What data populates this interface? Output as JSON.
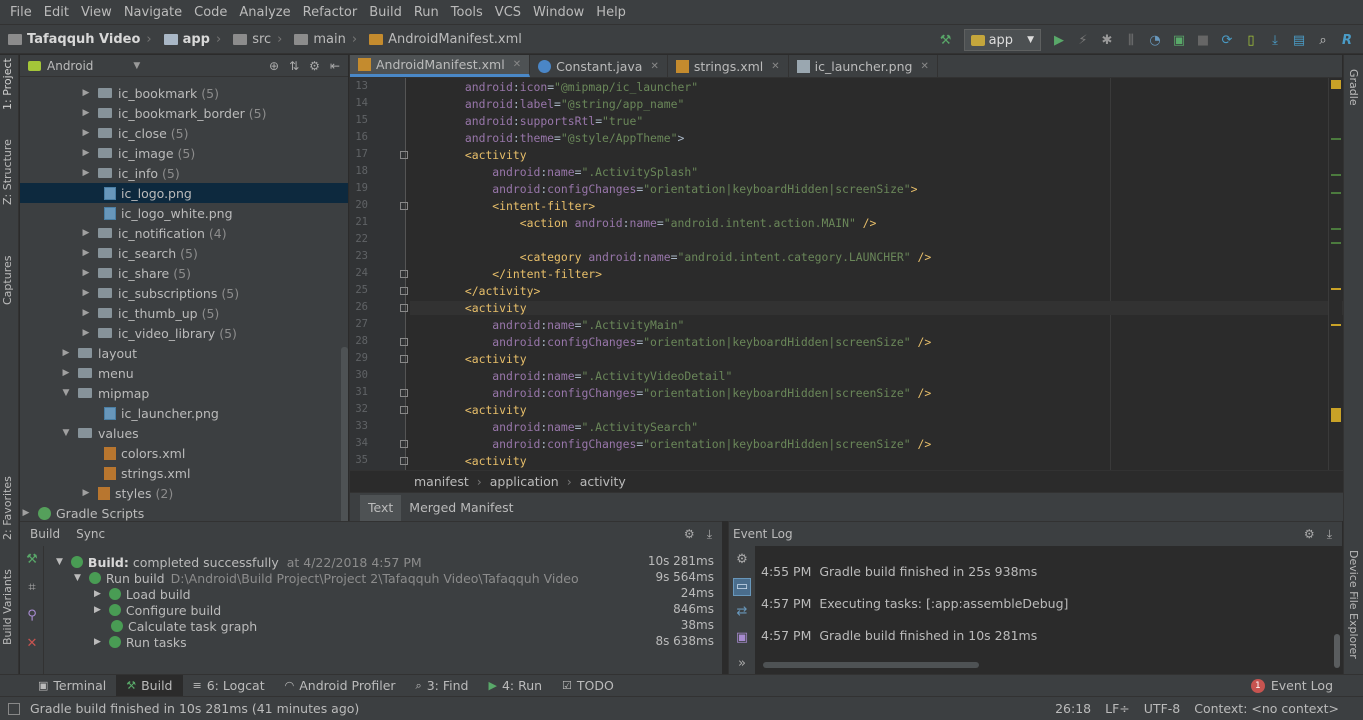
{
  "menu": [
    "File",
    "Edit",
    "View",
    "Navigate",
    "Code",
    "Analyze",
    "Refactor",
    "Build",
    "Run",
    "Tools",
    "VCS",
    "Window",
    "Help"
  ],
  "nav": {
    "project": "Tafaqquh Video",
    "app": "app",
    "src": "src",
    "main": "main",
    "file": "AndroidManifest.xml",
    "run_config": "app"
  },
  "left_strip": {
    "project": "1: Project",
    "structure": "Z: Structure",
    "captures": "Captures",
    "favorites": "2: Favorites",
    "build_variants": "Build Variants"
  },
  "right_strip": {
    "gradle": "Gradle",
    "device_explorer": "Device File Explorer"
  },
  "project_panel": {
    "view": "Android",
    "rows": [
      {
        "label": "ic_bookmark",
        "count": "(5)"
      },
      {
        "label": "ic_bookmark_border",
        "count": "(5)"
      },
      {
        "label": "ic_close",
        "count": "(5)"
      },
      {
        "label": "ic_image",
        "count": "(5)"
      },
      {
        "label": "ic_info",
        "count": "(5)"
      },
      {
        "label": "ic_logo.png",
        "count": ""
      },
      {
        "label": "ic_logo_white.png",
        "count": ""
      },
      {
        "label": "ic_notification",
        "count": "(4)"
      },
      {
        "label": "ic_search",
        "count": "(5)"
      },
      {
        "label": "ic_share",
        "count": "(5)"
      },
      {
        "label": "ic_subscriptions",
        "count": "(5)"
      },
      {
        "label": "ic_thumb_up",
        "count": "(5)"
      },
      {
        "label": "ic_video_library",
        "count": "(5)"
      },
      {
        "label": "layout",
        "count": ""
      },
      {
        "label": "menu",
        "count": ""
      },
      {
        "label": "mipmap",
        "count": ""
      },
      {
        "label": "ic_launcher.png",
        "count": ""
      },
      {
        "label": "values",
        "count": ""
      },
      {
        "label": "colors.xml",
        "count": ""
      },
      {
        "label": "strings.xml",
        "count": ""
      },
      {
        "label": "styles",
        "count": "(2)"
      },
      {
        "label": "Gradle Scripts",
        "count": ""
      }
    ]
  },
  "editor_tabs": [
    "AndroidManifest.xml",
    "Constant.java",
    "strings.xml",
    "ic_launcher.png"
  ],
  "code": {
    "line_numbers": [
      "13",
      "14",
      "15",
      "16",
      "17",
      "18",
      "19",
      "20",
      "21",
      "22",
      "23",
      "24",
      "25",
      "26",
      "27",
      "28",
      "29",
      "30",
      "31",
      "32",
      "33",
      "34",
      "35"
    ]
  },
  "breadcrumb": [
    "manifest",
    "application",
    "activity"
  ],
  "editor_bottom_tabs": [
    "Text",
    "Merged Manifest"
  ],
  "build_panel": {
    "tabs": [
      "Build",
      "Sync"
    ],
    "title": "Build:",
    "status": "completed successfully",
    "date": "at 4/22/2018 4:57 PM",
    "total_time": "10s 281ms",
    "run_build": "Run build",
    "run_path": "D:\\Android\\Build Project\\Project 2\\Tafaqquh Video\\Tafaqquh Video",
    "run_time": "9s 564ms",
    "steps": [
      {
        "label": "Load build",
        "time": "24ms"
      },
      {
        "label": "Configure build",
        "time": "846ms"
      },
      {
        "label": "Calculate task graph",
        "time": "38ms"
      },
      {
        "label": "Run tasks",
        "time": "8s 638ms"
      }
    ]
  },
  "event_log": {
    "title": "Event Log",
    "entries": [
      {
        "time": "4:55 PM",
        "msg": "Gradle build finished in 25s 938ms"
      },
      {
        "time": "4:57 PM",
        "msg": "Executing tasks: [:app:assembleDebug]"
      },
      {
        "time": "4:57 PM",
        "msg": "Gradle build finished in 10s 281ms"
      }
    ]
  },
  "bottom_tabs": {
    "terminal": "Terminal",
    "build": "Build",
    "logcat": "6: Logcat",
    "profiler": "Android Profiler",
    "find": "3: Find",
    "run": "4: Run",
    "todo": "TODO",
    "event_log": "Event Log",
    "event_count": "1"
  },
  "status": {
    "message": "Gradle build finished in 10s 281ms (41 minutes ago)",
    "position": "26:18",
    "line_sep": "LF÷",
    "encoding": "UTF-8",
    "context": "Context: <no context>"
  }
}
